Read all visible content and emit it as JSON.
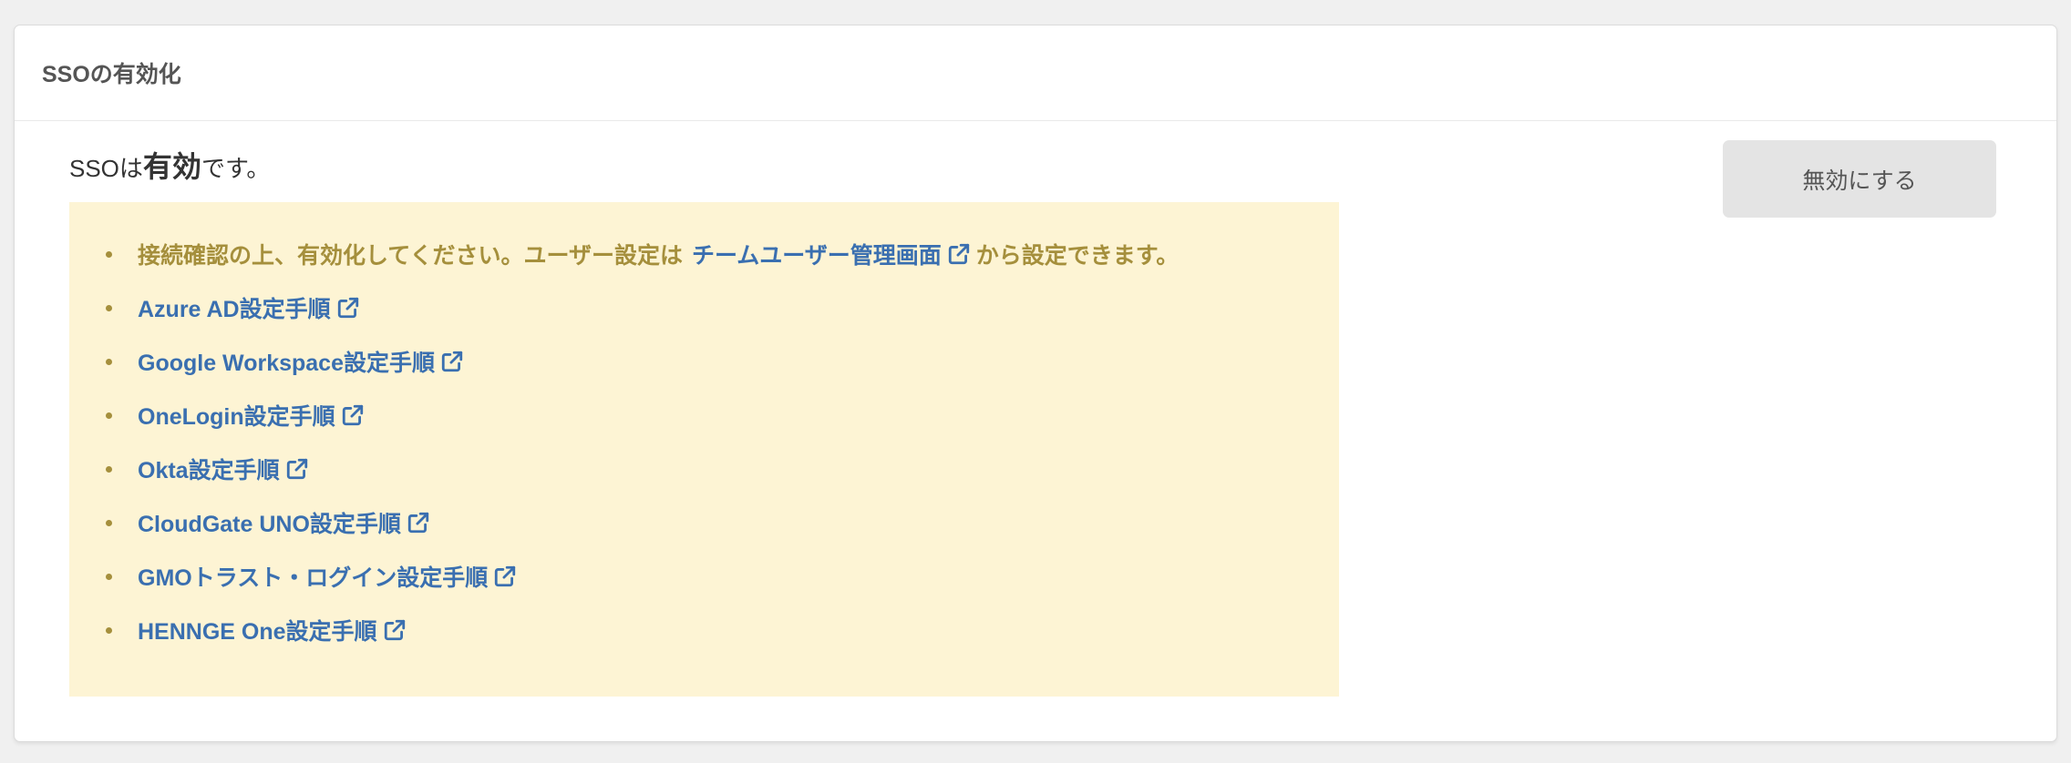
{
  "panel": {
    "title": "SSOの有効化"
  },
  "status": {
    "prefix": "SSOは",
    "value": "有効",
    "suffix": "です。"
  },
  "disable_button": {
    "label": "無効にする"
  },
  "info": {
    "note": {
      "before": "接続確認の上、有効化してください。ユーザー設定は",
      "link": "チームユーザー管理画面",
      "after": "から設定できます。"
    },
    "guides": [
      {
        "label": "Azure AD設定手順"
      },
      {
        "label": "Google Workspace設定手順"
      },
      {
        "label": "OneLogin設定手順"
      },
      {
        "label": "Okta設定手順"
      },
      {
        "label": "CloudGate UNO設定手順"
      },
      {
        "label": "GMOトラスト・ログイン設定手順"
      },
      {
        "label": "HENNGE One設定手順"
      }
    ]
  },
  "colors": {
    "link": "#3a6fb0",
    "note": "#a58f3c",
    "info_background": "#fdf4d4",
    "button_background": "#e4e4e4"
  },
  "icons": {
    "external_link": "external-link-icon"
  }
}
